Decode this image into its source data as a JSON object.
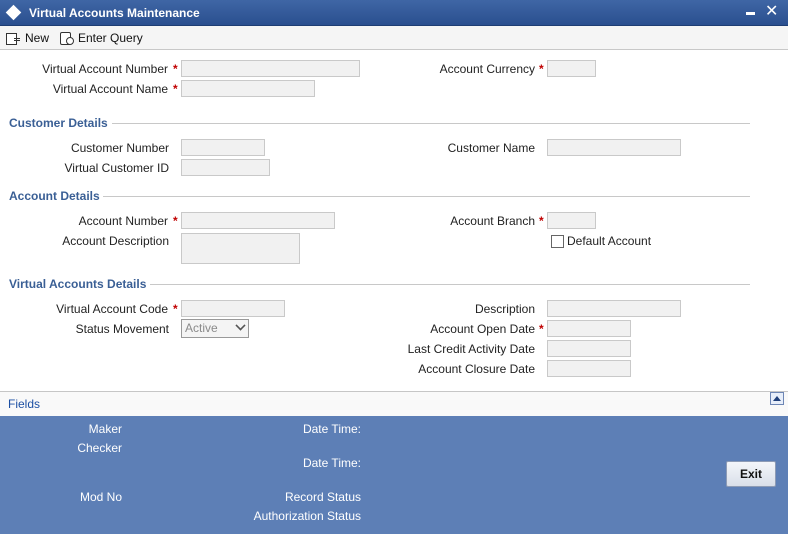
{
  "window": {
    "title": "Virtual Accounts Maintenance"
  },
  "toolbar": {
    "new_label": "New",
    "enter_query_label": "Enter Query"
  },
  "main": {
    "virtual_account_number_label": "Virtual Account Number",
    "virtual_account_name_label": "Virtual Account Name",
    "account_currency_label": "Account Currency",
    "required_marker": "*"
  },
  "customer_details": {
    "title": "Customer Details",
    "customer_number_label": "Customer Number",
    "virtual_customer_id_label": "Virtual Customer ID",
    "customer_name_label": "Customer Name"
  },
  "account_details": {
    "title": "Account Details",
    "account_number_label": "Account Number",
    "account_description_label": "Account Description",
    "account_branch_label": "Account Branch",
    "default_account_label": "Default Account"
  },
  "virtual_accounts_details": {
    "title": "Virtual Accounts Details",
    "virtual_account_code_label": "Virtual Account Code",
    "status_movement_label": "Status Movement",
    "status_movement_value": "Active",
    "description_label": "Description",
    "account_open_date_label": "Account Open Date",
    "last_credit_activity_date_label": "Last Credit Activity Date",
    "account_closure_date_label": "Account Closure Date"
  },
  "fields_bar": {
    "label": "Fields"
  },
  "footer": {
    "maker_label": "Maker",
    "checker_label": "Checker",
    "date_time_label": "Date Time:",
    "mod_no_label": "Mod No",
    "record_status_label": "Record Status",
    "authorization_status_label": "Authorization Status",
    "exit_label": "Exit"
  }
}
